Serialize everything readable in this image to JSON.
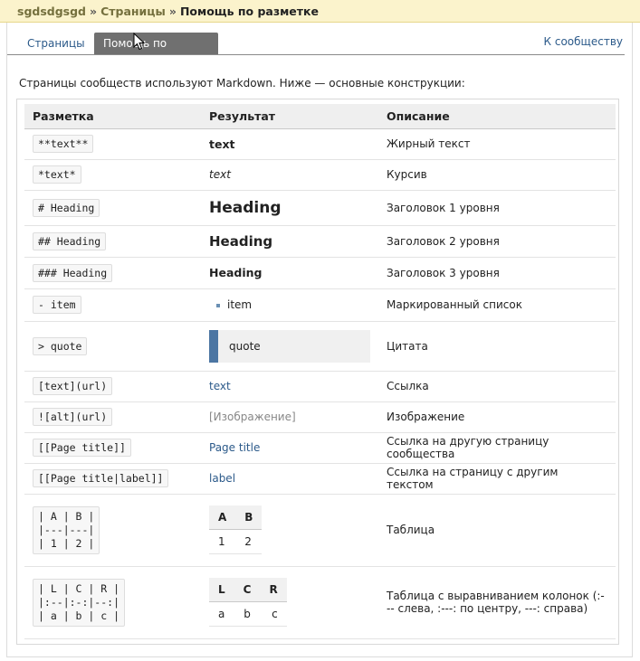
{
  "breadcrumb": {
    "group": "sgdsdgsgd",
    "separator": "»",
    "section": "Страницы",
    "current": "Помощь по разметке"
  },
  "tabs": {
    "pages": "Страницы",
    "help": "Помощь по разметке",
    "community": "К сообществу"
  },
  "intro": "Страницы сообществ используют Markdown. Ниже — основные конструкции:",
  "table": {
    "headers": [
      "Разметка",
      "Результат",
      "Описание"
    ],
    "rows": [
      {
        "markup": "**text**",
        "result": "text",
        "desc": "Жирный текст"
      },
      {
        "markup": "*text*",
        "result": "text",
        "desc": "Курсив"
      },
      {
        "markup": "# Heading",
        "result": "Heading",
        "desc": "Заголовок 1 уровня"
      },
      {
        "markup": "## Heading",
        "result": "Heading",
        "desc": "Заголовок 2 уровня"
      },
      {
        "markup": "### Heading",
        "result": "Heading",
        "desc": "Заголовок 3 уровня"
      },
      {
        "markup": "- item",
        "result": "item",
        "desc": "Маркированный список"
      },
      {
        "markup": "> quote",
        "result": "quote",
        "desc": "Цитата"
      },
      {
        "markup": "[text](url)",
        "result": "text",
        "desc": "Ссылка"
      },
      {
        "markup": "![alt](url)",
        "result": "[Изображение]",
        "desc": "Изображение"
      },
      {
        "markup": "[[Page title]]",
        "result": "Page title",
        "desc": "Ссылка на другую страницу сообщества"
      },
      {
        "markup": "[[Page title|label]]",
        "result": "label",
        "desc": "Ссылка на страницу с другим текстом"
      },
      {
        "markup": "| A | B |\n|---|---|\n| 1 | 2 |",
        "result_table": {
          "headers": [
            "A",
            "B"
          ],
          "cells": [
            "1",
            "2"
          ]
        },
        "desc": "Таблица"
      },
      {
        "markup": "| L | C | R |\n|:--|:-:|--:|\n| a | b | c |",
        "result_table": {
          "headers": [
            "L",
            "C",
            "R"
          ],
          "cells": [
            "a",
            "b",
            "c"
          ]
        },
        "desc": "Таблица с выравниванием колонок (:--- слева, :---: по центру, ---: справа)"
      }
    ]
  },
  "colors": {
    "accent": "#2c5a8a",
    "active_tab": "#707070",
    "topbar": "#fbf3cc",
    "quote_bar": "#4c76a3"
  }
}
